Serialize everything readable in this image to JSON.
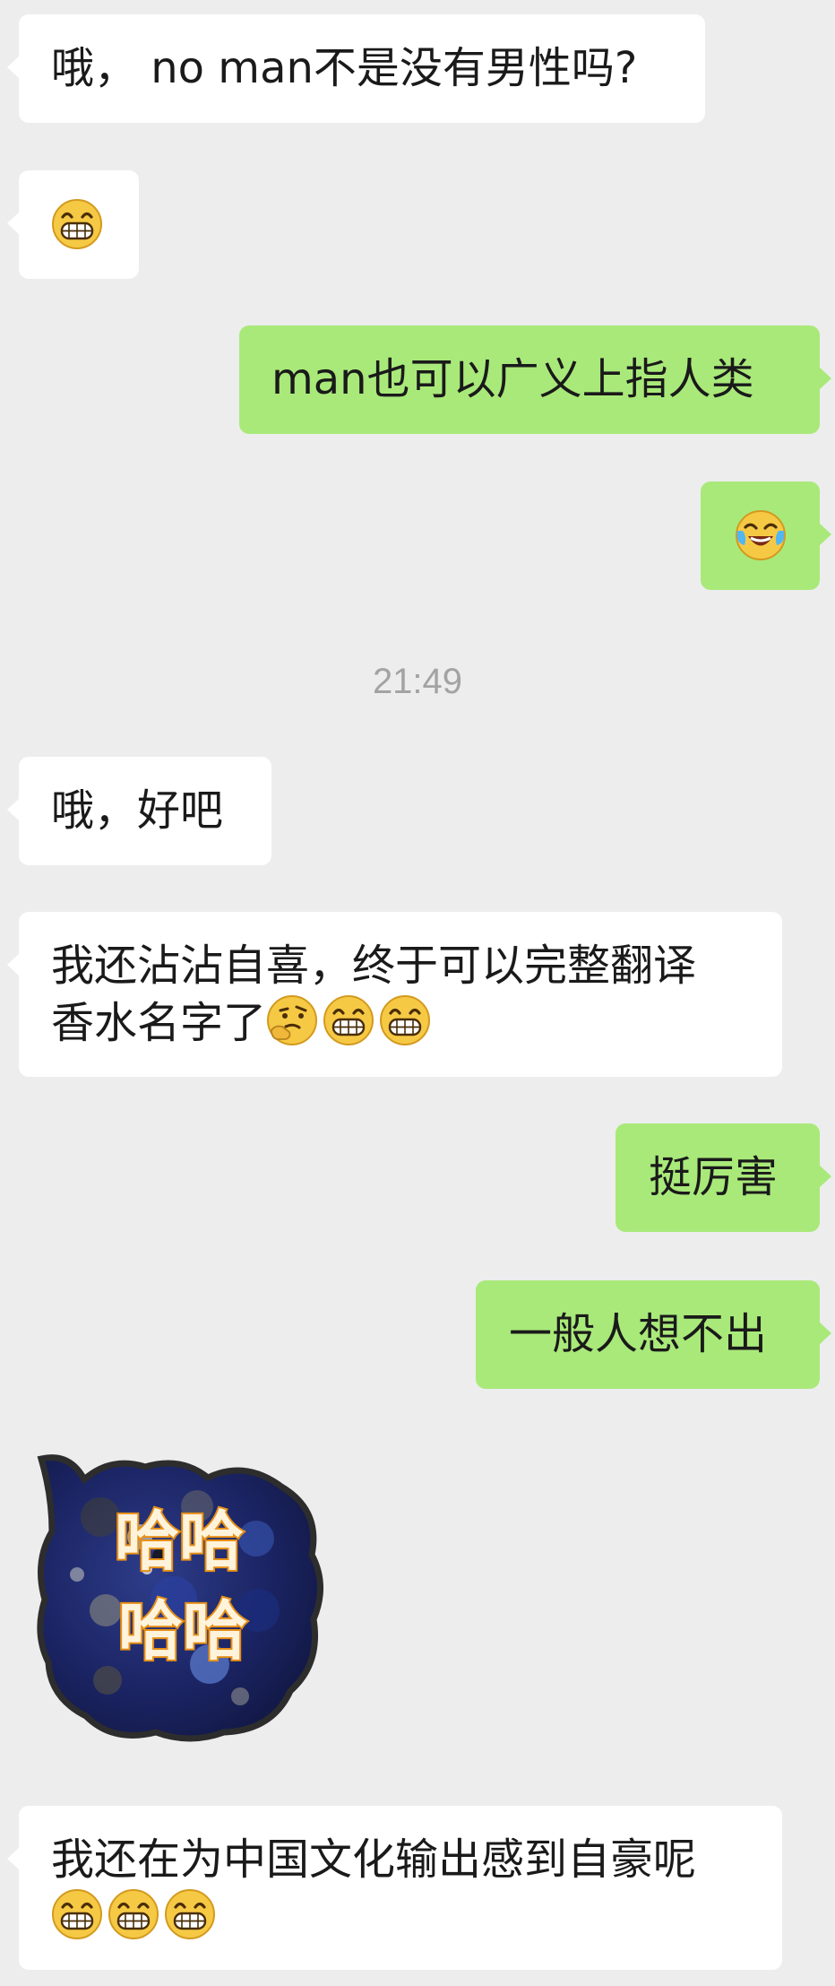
{
  "messages": [
    {
      "side": "in",
      "text": "哦， no man不是没有男性吗?"
    },
    {
      "side": "in",
      "emoji": [
        "grin-emoji"
      ]
    },
    {
      "side": "out",
      "text": "man也可以广义上指人类"
    },
    {
      "side": "out",
      "emoji": [
        "laugh-cry-emoji"
      ]
    },
    {
      "timestamp": "21:49"
    },
    {
      "side": "in",
      "text": "哦，好吧"
    },
    {
      "side": "in",
      "text_line1": "我还沾沾自喜，终于可以完整翻译",
      "text_line2": "香水名字了",
      "emoji": [
        "thinking-emoji",
        "grin-emoji",
        "grin-emoji"
      ]
    },
    {
      "side": "out",
      "text": "挺厉害"
    },
    {
      "side": "out",
      "text": "一般人想不出"
    },
    {
      "side": "in",
      "sticker": {
        "text_top": "哈哈",
        "text_bottom": "哈哈"
      }
    },
    {
      "side": "in",
      "text": "我还在为中国文化输出感到自豪呢",
      "emoji": [
        "grin-emoji",
        "grin-emoji",
        "grin-emoji"
      ]
    }
  ],
  "colors": {
    "background": "#EDEDED",
    "incoming_bubble": "#FFFFFF",
    "outgoing_bubble": "#A9E97A",
    "timestamp": "#A3A3A3",
    "text": "#1A1A1A"
  }
}
